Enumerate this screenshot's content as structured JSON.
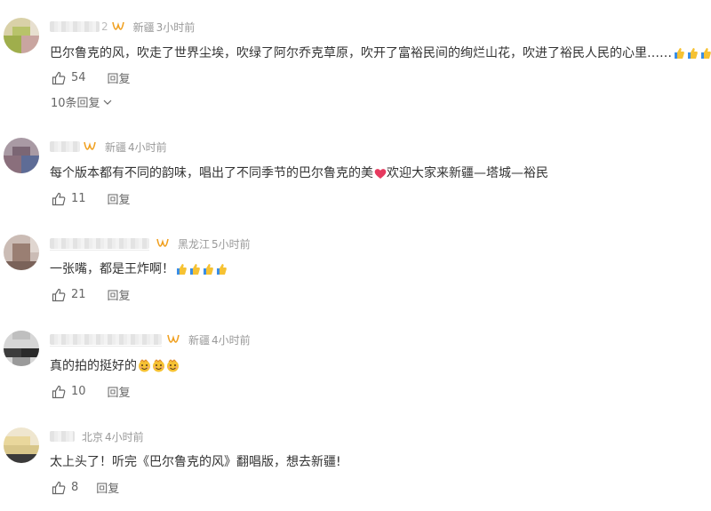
{
  "comments": [
    {
      "user_suffix": "2",
      "location": "新疆",
      "time": "3小时前",
      "text": "巴尔鲁克的风，吹走了世界尘埃，吹绿了阿尔乔克草原，吹开了富裕民间的绚烂山花，吹进了裕民人民的心里……",
      "emoji": "thumbs-up-icon x3",
      "likes": "54",
      "reply_label": "回复",
      "replies_link": "10条回复"
    },
    {
      "location": "新疆",
      "time": "4小时前",
      "text": "每个版本都有不同的韵味，唱出了不同季节的巴尔鲁克的美",
      "text2": "欢迎大家来新疆—塔城—裕民",
      "emoji": "heart-icon",
      "likes": "11",
      "reply_label": "回复"
    },
    {
      "location": "黑龙江",
      "time": "5小时前",
      "text": "一张嘴，都是王炸啊！",
      "emoji": "thumbs-up-icon x4",
      "likes": "21",
      "reply_label": "回复"
    },
    {
      "location": "新疆",
      "time": "4小时前",
      "text": "真的拍的挺好的",
      "emoji": "smile-face-icon x3",
      "likes": "10",
      "reply_label": "回复"
    },
    {
      "location": "北京",
      "time": "4小时前",
      "text": "太上头了！听完《巴尔鲁克的风》翻唱版，想去新疆!",
      "likes": "8",
      "reply_label": "回复"
    }
  ],
  "colors": {
    "text": "#333333",
    "meta": "#999999",
    "vip_gold": "#f0a020",
    "thumb_yellow": "#f6c233",
    "heart": "#e63a5f"
  }
}
